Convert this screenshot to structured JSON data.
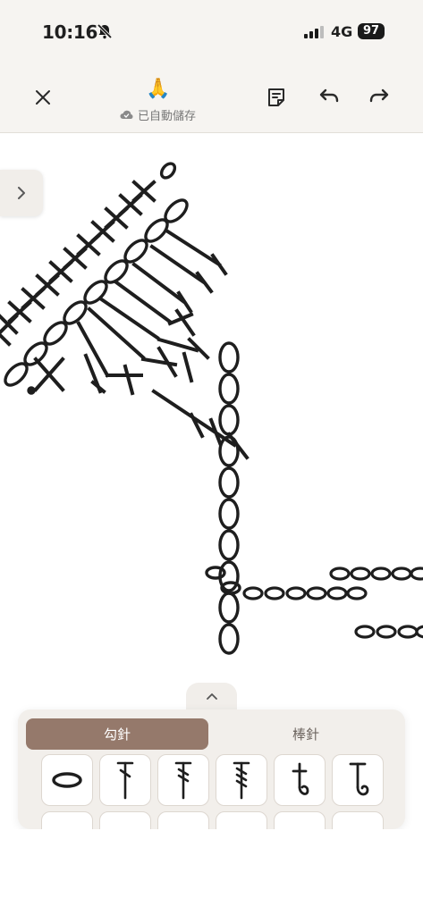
{
  "status_bar": {
    "time": "10:16",
    "network": "4G",
    "battery": "97"
  },
  "toolbar": {
    "emoji": "🙏",
    "autosave_label": "已自動儲存"
  },
  "tool_panel": {
    "tabs": [
      {
        "label": "勾針",
        "active": true
      },
      {
        "label": "棒針",
        "active": false
      }
    ],
    "symbols": [
      "chain",
      "double-crochet",
      "treble-crochet",
      "double-treble-crochet",
      "front-post-stitch",
      "back-post-stitch"
    ]
  },
  "colors": {
    "accent": "#95796b",
    "panel_bg": "#f2efeb",
    "stroke": "#222222"
  }
}
